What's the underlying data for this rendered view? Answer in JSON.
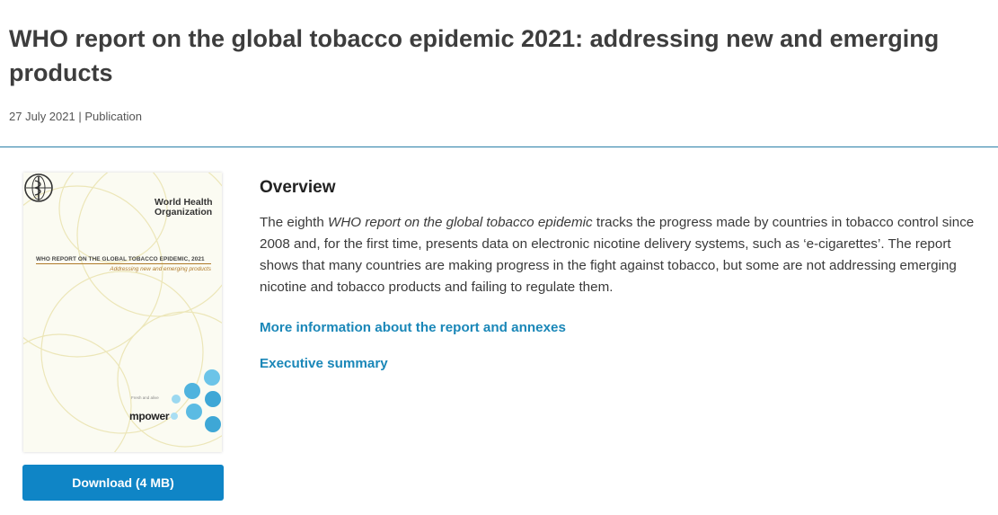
{
  "page": {
    "title": "WHO report on the global tobacco epidemic 2021: addressing new and emerging products",
    "meta": "27 July 2021 | Publication"
  },
  "cover": {
    "org_line1": "World Health",
    "org_line2": "Organization",
    "title": "WHO REPORT ON THE GLOBAL TOBACCO EPIDEMIC, 2021",
    "subtitle": "Addressing new and emerging products",
    "fresh_text": "Fresh and alive",
    "brand": "mpower",
    "logo_icon": "who-emblem-icon"
  },
  "download": {
    "label": "Download (4 MB)"
  },
  "overview": {
    "heading": "Overview",
    "text_before": "The eighth ",
    "text_italic": "WHO report on the global tobacco epidemic",
    "text_after": " tracks the progress made by countries in tobacco control since 2008 and, for the first time, presents data on electronic nicotine delivery systems, such as ‘e-cigarettes’. The report shows that many countries are making progress in the fight against tobacco, but some are not addressing emerging nicotine and tobacco products and failing to regulate them."
  },
  "links": {
    "more_info": "More information about the report and annexes",
    "exec_summary": "Executive summary"
  },
  "colors": {
    "accent_blue": "#0f85c6",
    "link_blue": "#1a87b8",
    "divider": "#2b7fa8"
  }
}
